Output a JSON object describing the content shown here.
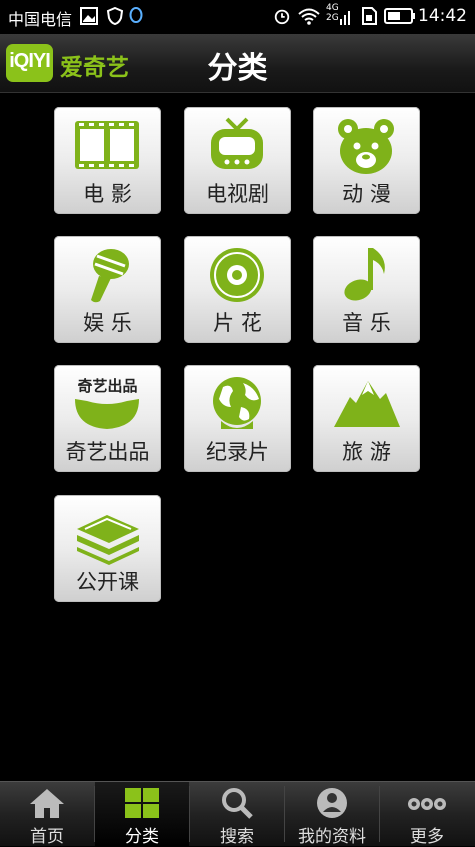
{
  "status_bar": {
    "carrier": "中国电信",
    "network": "4G",
    "network2": "2G",
    "time": "14:42"
  },
  "header": {
    "logo_badge": "iQIYI",
    "logo_name": "爱奇艺",
    "title": "分类"
  },
  "categories": [
    {
      "label": "电 影",
      "icon": "film-icon"
    },
    {
      "label": "电视剧",
      "icon": "tv-icon"
    },
    {
      "label": "动 漫",
      "icon": "bear-icon"
    },
    {
      "label": "娱 乐",
      "icon": "microphone-icon"
    },
    {
      "label": "片 花",
      "icon": "disc-icon"
    },
    {
      "label": "音 乐",
      "icon": "music-note-icon"
    },
    {
      "label": "奇艺出品",
      "icon": "speech-bubble-icon",
      "icon_text": "奇艺出品"
    },
    {
      "label": "纪录片",
      "icon": "globe-icon"
    },
    {
      "label": "旅 游",
      "icon": "mountain-icon"
    },
    {
      "label": "公开课",
      "icon": "books-icon"
    }
  ],
  "bottom_nav": [
    {
      "label": "首页",
      "icon": "home-icon",
      "active": false
    },
    {
      "label": "分类",
      "icon": "grid-icon",
      "active": true
    },
    {
      "label": "搜索",
      "icon": "search-icon",
      "active": false
    },
    {
      "label": "我的资料",
      "icon": "profile-icon",
      "active": false
    },
    {
      "label": "更多",
      "icon": "more-icon",
      "active": false
    }
  ],
  "colors": {
    "accent": "#8bc21a",
    "icon_green": "#7fb21a",
    "background": "#000000"
  }
}
